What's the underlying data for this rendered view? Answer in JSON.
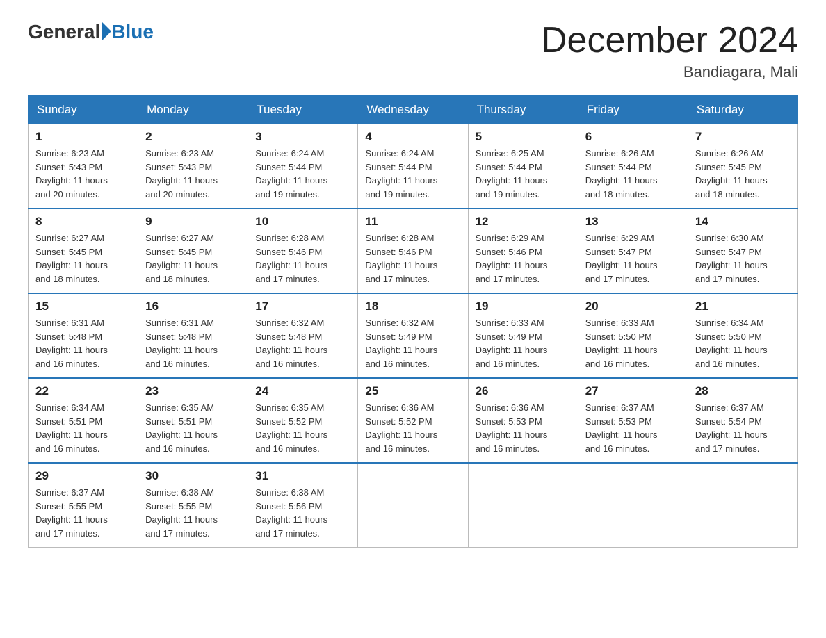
{
  "logo": {
    "general": "General",
    "blue": "Blue"
  },
  "title": {
    "main": "December 2024",
    "sub": "Bandiagara, Mali"
  },
  "weekdays": [
    "Sunday",
    "Monday",
    "Tuesday",
    "Wednesday",
    "Thursday",
    "Friday",
    "Saturday"
  ],
  "weeks": [
    [
      {
        "day": "1",
        "sunrise": "6:23 AM",
        "sunset": "5:43 PM",
        "daylight": "11 hours and 20 minutes."
      },
      {
        "day": "2",
        "sunrise": "6:23 AM",
        "sunset": "5:43 PM",
        "daylight": "11 hours and 20 minutes."
      },
      {
        "day": "3",
        "sunrise": "6:24 AM",
        "sunset": "5:44 PM",
        "daylight": "11 hours and 19 minutes."
      },
      {
        "day": "4",
        "sunrise": "6:24 AM",
        "sunset": "5:44 PM",
        "daylight": "11 hours and 19 minutes."
      },
      {
        "day": "5",
        "sunrise": "6:25 AM",
        "sunset": "5:44 PM",
        "daylight": "11 hours and 19 minutes."
      },
      {
        "day": "6",
        "sunrise": "6:26 AM",
        "sunset": "5:44 PM",
        "daylight": "11 hours and 18 minutes."
      },
      {
        "day": "7",
        "sunrise": "6:26 AM",
        "sunset": "5:45 PM",
        "daylight": "11 hours and 18 minutes."
      }
    ],
    [
      {
        "day": "8",
        "sunrise": "6:27 AM",
        "sunset": "5:45 PM",
        "daylight": "11 hours and 18 minutes."
      },
      {
        "day": "9",
        "sunrise": "6:27 AM",
        "sunset": "5:45 PM",
        "daylight": "11 hours and 18 minutes."
      },
      {
        "day": "10",
        "sunrise": "6:28 AM",
        "sunset": "5:46 PM",
        "daylight": "11 hours and 17 minutes."
      },
      {
        "day": "11",
        "sunrise": "6:28 AM",
        "sunset": "5:46 PM",
        "daylight": "11 hours and 17 minutes."
      },
      {
        "day": "12",
        "sunrise": "6:29 AM",
        "sunset": "5:46 PM",
        "daylight": "11 hours and 17 minutes."
      },
      {
        "day": "13",
        "sunrise": "6:29 AM",
        "sunset": "5:47 PM",
        "daylight": "11 hours and 17 minutes."
      },
      {
        "day": "14",
        "sunrise": "6:30 AM",
        "sunset": "5:47 PM",
        "daylight": "11 hours and 17 minutes."
      }
    ],
    [
      {
        "day": "15",
        "sunrise": "6:31 AM",
        "sunset": "5:48 PM",
        "daylight": "11 hours and 16 minutes."
      },
      {
        "day": "16",
        "sunrise": "6:31 AM",
        "sunset": "5:48 PM",
        "daylight": "11 hours and 16 minutes."
      },
      {
        "day": "17",
        "sunrise": "6:32 AM",
        "sunset": "5:48 PM",
        "daylight": "11 hours and 16 minutes."
      },
      {
        "day": "18",
        "sunrise": "6:32 AM",
        "sunset": "5:49 PM",
        "daylight": "11 hours and 16 minutes."
      },
      {
        "day": "19",
        "sunrise": "6:33 AM",
        "sunset": "5:49 PM",
        "daylight": "11 hours and 16 minutes."
      },
      {
        "day": "20",
        "sunrise": "6:33 AM",
        "sunset": "5:50 PM",
        "daylight": "11 hours and 16 minutes."
      },
      {
        "day": "21",
        "sunrise": "6:34 AM",
        "sunset": "5:50 PM",
        "daylight": "11 hours and 16 minutes."
      }
    ],
    [
      {
        "day": "22",
        "sunrise": "6:34 AM",
        "sunset": "5:51 PM",
        "daylight": "11 hours and 16 minutes."
      },
      {
        "day": "23",
        "sunrise": "6:35 AM",
        "sunset": "5:51 PM",
        "daylight": "11 hours and 16 minutes."
      },
      {
        "day": "24",
        "sunrise": "6:35 AM",
        "sunset": "5:52 PM",
        "daylight": "11 hours and 16 minutes."
      },
      {
        "day": "25",
        "sunrise": "6:36 AM",
        "sunset": "5:52 PM",
        "daylight": "11 hours and 16 minutes."
      },
      {
        "day": "26",
        "sunrise": "6:36 AM",
        "sunset": "5:53 PM",
        "daylight": "11 hours and 16 minutes."
      },
      {
        "day": "27",
        "sunrise": "6:37 AM",
        "sunset": "5:53 PM",
        "daylight": "11 hours and 16 minutes."
      },
      {
        "day": "28",
        "sunrise": "6:37 AM",
        "sunset": "5:54 PM",
        "daylight": "11 hours and 17 minutes."
      }
    ],
    [
      {
        "day": "29",
        "sunrise": "6:37 AM",
        "sunset": "5:55 PM",
        "daylight": "11 hours and 17 minutes."
      },
      {
        "day": "30",
        "sunrise": "6:38 AM",
        "sunset": "5:55 PM",
        "daylight": "11 hours and 17 minutes."
      },
      {
        "day": "31",
        "sunrise": "6:38 AM",
        "sunset": "5:56 PM",
        "daylight": "11 hours and 17 minutes."
      },
      null,
      null,
      null,
      null
    ]
  ],
  "labels": {
    "sunrise_prefix": "Sunrise: ",
    "sunset_prefix": "Sunset: ",
    "daylight_prefix": "Daylight: "
  }
}
